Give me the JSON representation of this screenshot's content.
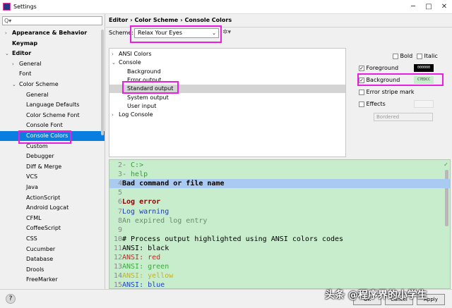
{
  "window": {
    "title": "Settings",
    "minimize": "─",
    "maximize": "□",
    "close": "✕"
  },
  "search": {
    "icon": "Q▾",
    "value": ""
  },
  "tree": [
    {
      "label": "Appearance & Behavior",
      "bold": true,
      "arrow": "›",
      "level": 0
    },
    {
      "label": "Keymap",
      "bold": true,
      "arrow": "",
      "level": 0
    },
    {
      "label": "Editor",
      "bold": true,
      "arrow": "⌄",
      "level": 0
    },
    {
      "label": "General",
      "arrow": "›",
      "level": 1
    },
    {
      "label": "Font",
      "arrow": "",
      "level": 1
    },
    {
      "label": "Color Scheme",
      "arrow": "⌄",
      "level": 1
    },
    {
      "label": "General",
      "arrow": "",
      "level": 2
    },
    {
      "label": "Language Defaults",
      "arrow": "",
      "level": 2
    },
    {
      "label": "Color Scheme Font",
      "arrow": "",
      "level": 2
    },
    {
      "label": "Console Font",
      "arrow": "",
      "level": 2
    },
    {
      "label": "Console Colors",
      "arrow": "",
      "level": 2,
      "selected": true
    },
    {
      "label": "Custom",
      "arrow": "",
      "level": 2
    },
    {
      "label": "Debugger",
      "arrow": "",
      "level": 2
    },
    {
      "label": "Diff & Merge",
      "arrow": "",
      "level": 2
    },
    {
      "label": "VCS",
      "arrow": "",
      "level": 2
    },
    {
      "label": "Java",
      "arrow": "",
      "level": 2
    },
    {
      "label": "ActionScript",
      "arrow": "",
      "level": 2
    },
    {
      "label": "Android Logcat",
      "arrow": "",
      "level": 2
    },
    {
      "label": "CFML",
      "arrow": "",
      "level": 2
    },
    {
      "label": "CoffeeScript",
      "arrow": "",
      "level": 2
    },
    {
      "label": "CSS",
      "arrow": "",
      "level": 2
    },
    {
      "label": "Cucumber",
      "arrow": "",
      "level": 2
    },
    {
      "label": "Database",
      "arrow": "",
      "level": 2
    },
    {
      "label": "Drools",
      "arrow": "",
      "level": 2
    },
    {
      "label": "FreeMarker",
      "arrow": "",
      "level": 2
    }
  ],
  "breadcrumb": [
    "Editor",
    "›",
    "Color Scheme",
    "›",
    "Console Colors"
  ],
  "scheme": {
    "label": "Scheme:",
    "value": "Relax Your Eyes",
    "chevron": "⌄",
    "gear": "✲▾"
  },
  "elements": [
    {
      "label": "ANSI Colors",
      "arrow": "›",
      "level": 0
    },
    {
      "label": "Console",
      "arrow": "⌄",
      "level": 0
    },
    {
      "label": "Background",
      "arrow": "",
      "level": 1
    },
    {
      "label": "Error output",
      "arrow": "",
      "level": 1
    },
    {
      "label": "Standard output",
      "arrow": "",
      "level": 1,
      "selected": true
    },
    {
      "label": "System output",
      "arrow": "",
      "level": 1
    },
    {
      "label": "User input",
      "arrow": "",
      "level": 1
    },
    {
      "label": "Log Console",
      "arrow": "›",
      "level": 0
    }
  ],
  "props": {
    "bold": "Bold",
    "italic": "Italic",
    "foreground": "Foreground",
    "foreground_value": "000000",
    "background": "Background",
    "background_value": "C7EDCC",
    "error_stripe": "Error stripe mark",
    "effects": "Effects",
    "effects_style": "Bordered",
    "checkmark": "✓"
  },
  "preview": {
    "lines": [
      {
        "n": "2",
        "text": "- C:>",
        "color": "#3a9a3a",
        "bold": false
      },
      {
        "n": "3",
        "text": "- help",
        "color": "#3a9a3a",
        "bold": false
      },
      {
        "n": "4",
        "text": "Bad command or file name",
        "color": "#000000",
        "bold": true,
        "hl": true
      },
      {
        "n": "5",
        "text": "",
        "color": "#000000"
      },
      {
        "n": "6",
        "text": "Log error",
        "color": "#8b0000",
        "bold": true
      },
      {
        "n": "7",
        "text": "Log warning",
        "color": "#1f3fa6"
      },
      {
        "n": "8",
        "text": "An expired log entry",
        "color": "#6a8a6a"
      },
      {
        "n": "9",
        "text": "",
        "color": "#000000"
      },
      {
        "n": "10",
        "text": "# Process output highlighted using ANSI colors codes",
        "color": "#000000"
      },
      {
        "n": "11",
        "text": "ANSI: black",
        "color": "#000000"
      },
      {
        "n": "12",
        "text": "ANSI: red",
        "color": "#d42020"
      },
      {
        "n": "13",
        "text": "ANSI: green",
        "color": "#3aaa3a"
      },
      {
        "n": "14",
        "text": "ANSI: yellow",
        "color": "#c8b020"
      },
      {
        "n": "15",
        "text": "ANSI: blue",
        "color": "#2040d0"
      }
    ],
    "check": "✓"
  },
  "buttons": {
    "help": "?",
    "ok": "OK",
    "cancel": "Cancel",
    "apply": "Apply"
  },
  "watermark": "头条 @程序界的小学生",
  "colors": {
    "selection": "#0a7ee0",
    "highlight_box": "#e91ee0",
    "preview_bg": "#c7edcc"
  }
}
